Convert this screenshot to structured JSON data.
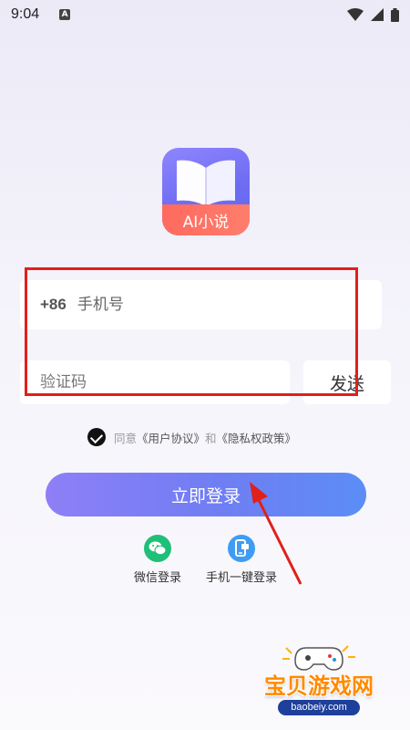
{
  "status_bar": {
    "time": "9:04",
    "notification_icon": "A",
    "icons": [
      "wifi-icon",
      "signal-icon",
      "battery-icon"
    ]
  },
  "app": {
    "logo_text": "AI小说",
    "colors": {
      "primary": "#6f7ef4",
      "logo_band": "#ff6a5f",
      "highlight": "#e0201a"
    }
  },
  "form": {
    "country_code": "+86",
    "phone_placeholder": "手机号",
    "code_placeholder": "验证码",
    "send_label": "发送"
  },
  "agreement": {
    "prefix": "同意",
    "user_agreement": "《用户协议》",
    "conjunction": "和",
    "privacy_policy": "《隐私权政策》"
  },
  "login_button": "立即登录",
  "alt_login": {
    "wechat_label": "微信登录",
    "onekey_label": "手机一键登录"
  },
  "watermark": {
    "title": "宝贝游戏网",
    "url": "baobeiy.com"
  }
}
